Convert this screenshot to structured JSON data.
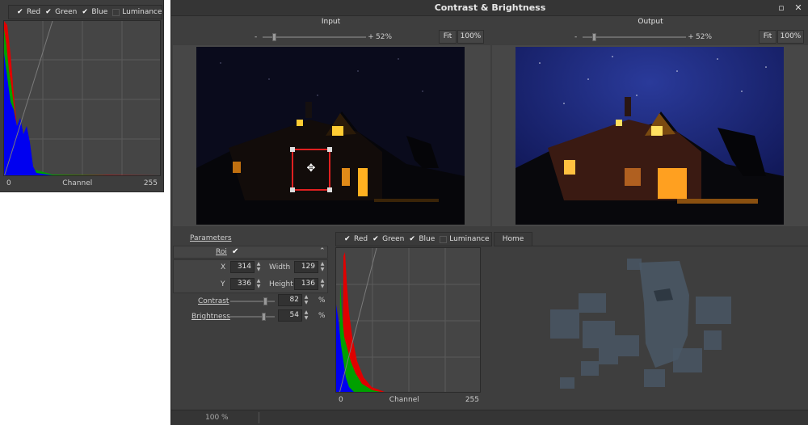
{
  "left_histogram": {
    "channels": [
      {
        "label": "Red",
        "checked": true
      },
      {
        "label": "Green",
        "checked": true
      },
      {
        "label": "Blue",
        "checked": true
      },
      {
        "label": "Luminance",
        "checked": false
      }
    ],
    "axis_min": "0",
    "axis_label": "Channel",
    "axis_max": "255"
  },
  "window": {
    "title": "Contrast & Brightness",
    "maximize_icon": "maximize-icon",
    "close_icon": "close-icon"
  },
  "input_panel": {
    "title": "Input",
    "zoom_minus": "-",
    "zoom_plus": "+",
    "zoom_value": "52%",
    "zoom_fraction": 0.1,
    "fit_label": "Fit",
    "actual_label": "100%"
  },
  "output_panel": {
    "title": "Output",
    "zoom_minus": "-",
    "zoom_plus": "+",
    "zoom_value": "52%",
    "zoom_fraction": 0.1,
    "fit_label": "Fit",
    "actual_label": "100%"
  },
  "parameters": {
    "header": "Parameters",
    "roi_label": "Roi",
    "roi_checked": true,
    "x_label": "X",
    "x_value": "314",
    "width_label": "Width",
    "width_value": "129",
    "y_label": "Y",
    "y_value": "336",
    "height_label": "Height",
    "height_value": "136",
    "contrast_label": "Contrast",
    "contrast_value": "82",
    "contrast_fraction": 0.82,
    "brightness_label": "Brightness",
    "brightness_value": "54",
    "brightness_fraction": 0.77,
    "percent_unit": "%"
  },
  "bottom_histogram": {
    "channels": [
      {
        "label": "Red",
        "checked": true
      },
      {
        "label": "Green",
        "checked": true
      },
      {
        "label": "Blue",
        "checked": true
      },
      {
        "label": "Luminance",
        "checked": false
      }
    ],
    "axis_min": "0",
    "axis_label": "Channel",
    "axis_max": "255"
  },
  "home_tab": "Home",
  "status": {
    "zoom": "100 %"
  },
  "colors": {
    "red": "#ff0000",
    "green": "#00b000",
    "blue": "#0000ff",
    "roi": "#e02020"
  }
}
